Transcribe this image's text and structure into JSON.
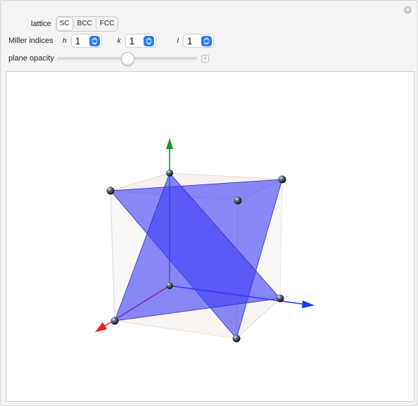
{
  "controls": {
    "lattice_label": "lattice",
    "lattice_options": [
      "SC",
      "BCC",
      "FCC"
    ],
    "lattice_selected": "SC",
    "miller_label": "Miller indices",
    "h": {
      "label": "h",
      "value": "1"
    },
    "k": {
      "label": "k",
      "value": "1"
    },
    "l": {
      "label": "l",
      "value": "1"
    },
    "opacity_label": "plane opacity",
    "opacity_value": 0.5
  },
  "icons": {
    "corner": "plus-circle-icon",
    "stepper": "up-down-chevron-icon",
    "slider_expand": "plus-icon"
  },
  "colors": {
    "plane": "#3c3cf5",
    "x_axis": "#e02020",
    "y_axis": "#1a3cf0",
    "z_axis": "#1a9a1a",
    "accent": "#2e7cf6"
  }
}
